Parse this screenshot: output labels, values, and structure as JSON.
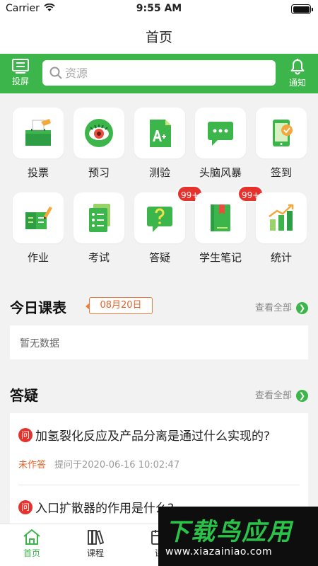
{
  "status_bar": {
    "carrier": "Carrier",
    "time": "9:55 AM"
  },
  "nav": {
    "title": "首页"
  },
  "toolbar": {
    "cast_label": "投屏",
    "notify_label": "通知",
    "search_placeholder": "资源",
    "accent_color": "#3cb54a"
  },
  "features": [
    {
      "label": "投票",
      "icon": "ballot-box-icon"
    },
    {
      "label": "预习",
      "icon": "eye-icon"
    },
    {
      "label": "测验",
      "icon": "grade-a-plus-icon"
    },
    {
      "label": "头脑风暴",
      "icon": "chat-bubble-icon"
    },
    {
      "label": "签到",
      "icon": "phone-checkin-icon"
    },
    {
      "label": "作业",
      "icon": "homework-pen-icon"
    },
    {
      "label": "考试",
      "icon": "exam-list-icon"
    },
    {
      "label": "答疑",
      "icon": "question-bubble-icon",
      "badge": "99+"
    },
    {
      "label": "学生笔记",
      "icon": "notebook-icon",
      "badge": "99+"
    },
    {
      "label": "统计",
      "icon": "bar-stats-icon"
    }
  ],
  "schedule": {
    "title": "今日课表",
    "date": "08月20日",
    "view_all": "查看全部",
    "empty_text": "暂无数据"
  },
  "qa": {
    "title": "答疑",
    "view_all": "查看全部",
    "items": [
      {
        "icon_text": "问",
        "question": "加氢裂化反应及产品分离是通过什么实现的?",
        "status": "未作答",
        "asked": "提问于2020-06-16 10:02:47"
      },
      {
        "icon_text": "问",
        "question": "入口扩散器的作用是什么?"
      }
    ]
  },
  "tabs": [
    {
      "label": "首页",
      "icon": "home-icon",
      "active": true
    },
    {
      "label": "课程",
      "icon": "books-icon"
    },
    {
      "label": "课",
      "icon": "calendar-icon"
    }
  ],
  "watermark": {
    "logo": "下载鸟应用",
    "url": "www.xiazainiao.com"
  }
}
